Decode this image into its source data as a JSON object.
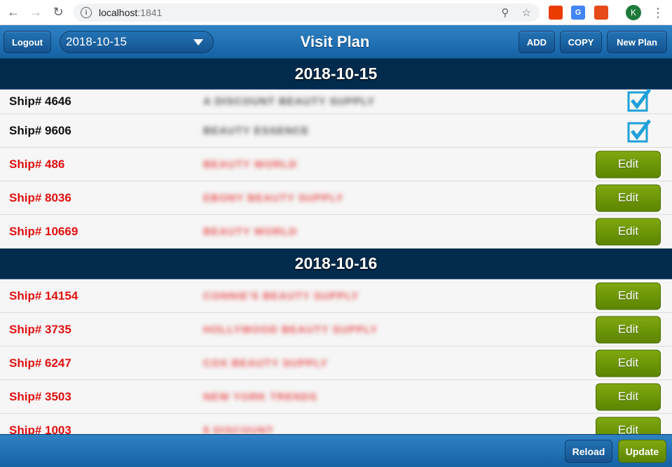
{
  "browser": {
    "url_host": "localhost",
    "url_port": ":1841",
    "profile_initial": "K",
    "translate_badge": "G"
  },
  "header": {
    "logout_label": "Logout",
    "date_selected": "2018-10-15",
    "title": "Visit Plan",
    "add_label": "ADD",
    "copy_label": "COPY",
    "new_plan_label": "New Plan"
  },
  "days": [
    {
      "date": "2018-10-15",
      "rows": [
        {
          "ship": "Ship# 4646",
          "store": "A DISCOUNT BEAUTY SUPPLY",
          "status": "done"
        },
        {
          "ship": "Ship# 9606",
          "store": "BEAUTY ESSENCE",
          "status": "done"
        },
        {
          "ship": "Ship# 486",
          "store": "BEAUTY WORLD",
          "status": "todo"
        },
        {
          "ship": "Ship# 8036",
          "store": "EBONY BEAUTY SUPPLY",
          "status": "todo"
        },
        {
          "ship": "Ship# 10669",
          "store": "BEAUTY WORLD",
          "status": "todo"
        }
      ]
    },
    {
      "date": "2018-10-16",
      "rows": [
        {
          "ship": "Ship# 14154",
          "store": "CONNIE'S BEAUTY SUPPLY",
          "status": "todo"
        },
        {
          "ship": "Ship# 3735",
          "store": "HOLLYWOOD BEAUTY SUPPLY",
          "status": "todo"
        },
        {
          "ship": "Ship# 6247",
          "store": "COX BEAUTY SUPPLY",
          "status": "todo"
        },
        {
          "ship": "Ship# 3503",
          "store": "NEW YORK TRENDS",
          "status": "todo"
        },
        {
          "ship": "Ship# 1003",
          "store": "$ DISCOUNT",
          "status": "todo"
        }
      ]
    }
  ],
  "edit_label": "Edit",
  "footer": {
    "reload_label": "Reload",
    "update_label": "Update"
  },
  "colors": {
    "header_blue": "#1f6fb2",
    "day_header": "#002b4c",
    "edit_green": "#6e9608",
    "pending_red": "#e01010",
    "check_blue": "#1ea0d8"
  }
}
